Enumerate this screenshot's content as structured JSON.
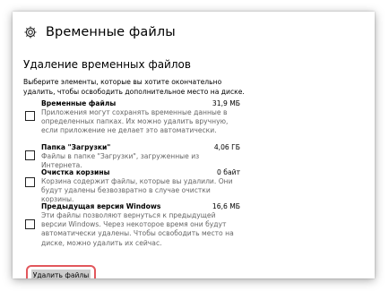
{
  "header": {
    "title": "Временные файлы",
    "icon": "gear-icon"
  },
  "section": {
    "subtitle": "Удаление временных файлов",
    "description": "Выберите элементы, которые вы хотите окончательно удалить, чтобы освободить дополнительное место на диске."
  },
  "items": [
    {
      "name": "Временные файлы",
      "size": "31,9 МБ",
      "description": "Приложения могут сохранять временные данные в определенных папках. Их можно удалить вручную, если приложение не делает это автоматически.",
      "checked": false
    },
    {
      "name": "Папка \"Загрузки\"",
      "size": "4,06 ГБ",
      "description": "Файлы в папке \"Загрузки\", загруженные из Интернета.",
      "checked": false
    },
    {
      "name": "Очистка корзины",
      "size": "0 байт",
      "description": "Корзина содержит файлы, которые вы удалили. Они будут удалены безвозвратно в случае очистки корзины.",
      "checked": false
    },
    {
      "name": "Предыдущая версия Windows",
      "size": "16,6 МБ",
      "description": "Эти файлы позволяют вернуться к предыдущей версии Windows. Через некоторое время они будут автоматически удалены. Чтобы освободить место на диске, можно удалить их сейчас.",
      "checked": false
    }
  ],
  "actions": {
    "delete_label": "Удалить файлы"
  },
  "colors": {
    "highlight_border": "#e2575c",
    "button_bg": "#cccccc",
    "secondary_text": "#666666"
  }
}
